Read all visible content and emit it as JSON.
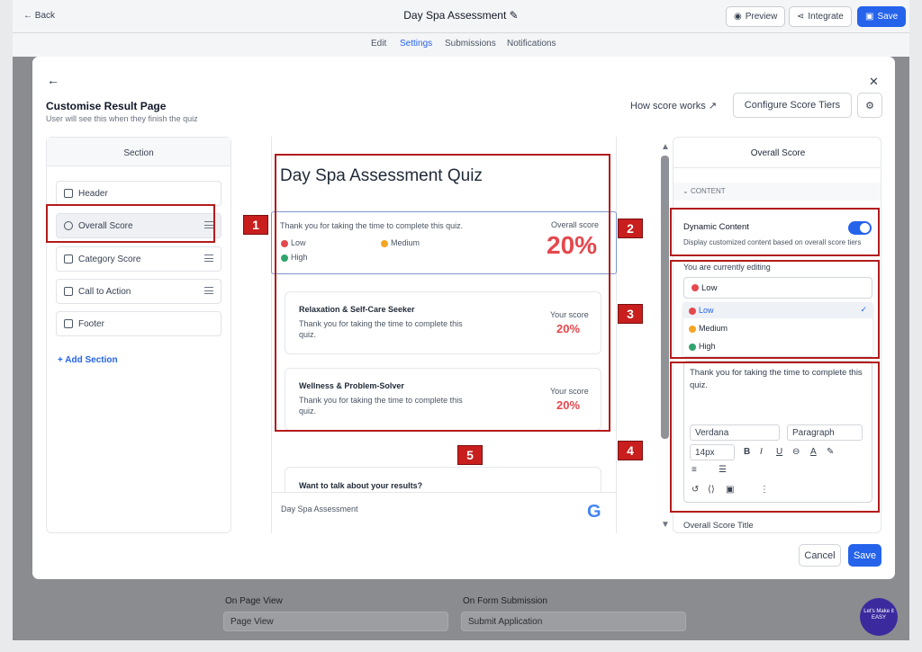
{
  "topbar": {
    "back": "Back",
    "title": "Day Spa Assessment",
    "preview": "Preview",
    "integrate": "Integrate",
    "save": "Save"
  },
  "tabs": [
    "Edit",
    "Settings",
    "Submissions",
    "Notifications"
  ],
  "bg": {
    "page_view_label": "On Page View",
    "page_view_value": "Page View",
    "form_sub_label": "On Form Submission",
    "form_sub_value": "Submit Application"
  },
  "modal": {
    "title": "Customise Result Page",
    "subtitle": "User will see this when they finish the quiz",
    "how_score": "How score works",
    "configure": "Configure Score Tiers",
    "cancel": "Cancel",
    "save": "Save",
    "sections_title": "Section",
    "sections": [
      "Header",
      "Overall Score",
      "Category Score",
      "Call to Action",
      "Footer"
    ],
    "add_section": "Add Section",
    "preview": {
      "quiz_title": "Day Spa Assessment Quiz",
      "thanks": "Thank you for taking the time to complete this quiz.",
      "overall_label": "Overall score",
      "overall_value": "20%",
      "tiers": [
        {
          "name": "Low",
          "color": "#e5484d"
        },
        {
          "name": "Medium",
          "color": "#f5a524"
        },
        {
          "name": "High",
          "color": "#30a46c"
        }
      ],
      "cards": [
        {
          "title": "Relaxation & Self-Care Seeker",
          "text1": "Thank you for taking the time to complete this",
          "text2": "quiz.",
          "score_label": "Your score",
          "score": "20%"
        },
        {
          "title": "Wellness & Problem-Solver",
          "text1": "Thank you for taking the time to complete this",
          "text2": "quiz.",
          "score_label": "Your score",
          "score": "20%"
        }
      ],
      "cta": "Want to talk about your results?",
      "footer": "Day Spa Assessment"
    },
    "right": {
      "title": "Overall Score",
      "content_label": "CONTENT",
      "dynamic_title": "Dynamic Content",
      "dynamic_desc": "Display customized content based on overall score tiers",
      "editing_label": "You are currently editing",
      "editing_value": "Low",
      "options": [
        "Low",
        "Medium",
        "High"
      ],
      "editor_text": "Thank you for taking the time to complete this quiz.",
      "font": "Verdana",
      "block": "Paragraph",
      "size": "14px",
      "next_label": "Overall Score Title"
    },
    "markers": [
      "1",
      "2",
      "3",
      "4",
      "5"
    ]
  },
  "watermark": "Let's Make it EASY"
}
